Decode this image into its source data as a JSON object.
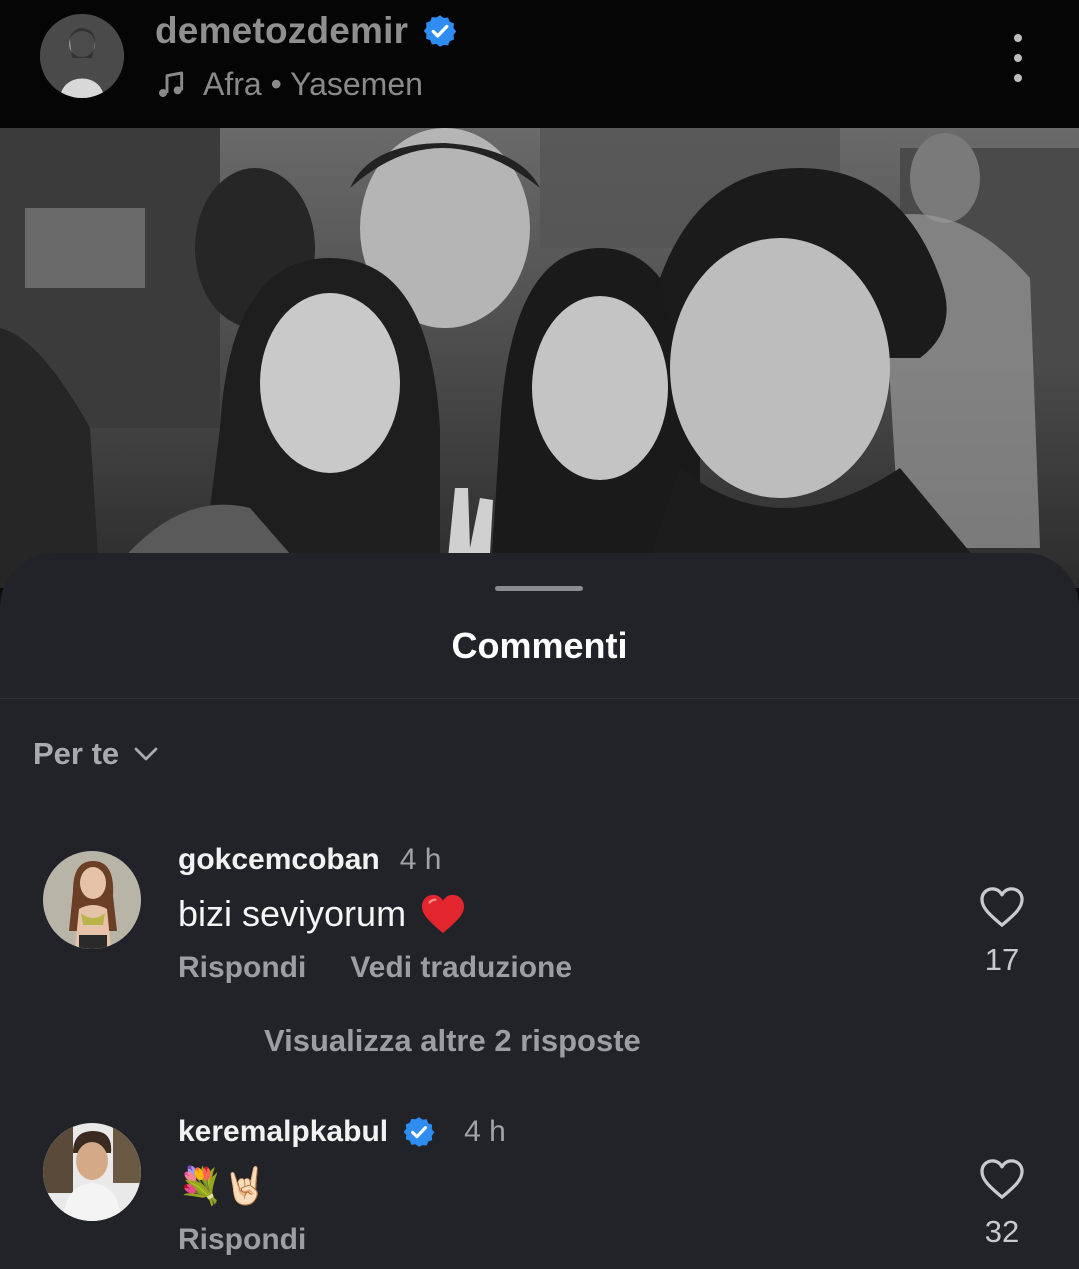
{
  "post": {
    "username": "demetozdemir",
    "music": "Afra • Yasemen"
  },
  "comments_sheet": {
    "title": "Commenti",
    "sort_label": "Per te",
    "comments": [
      {
        "username": "gokcemcoban",
        "time": "4 h",
        "text": "bizi seviyorum",
        "emoji": "❤️",
        "reply_label": "Rispondi",
        "translate_label": "Vedi traduzione",
        "likes": "17",
        "view_replies": "Visualizza altre 2 risposte"
      },
      {
        "username": "keremalpkabul",
        "time": "4 h",
        "text": "💐🤘🏻",
        "reply_label": "Rispondi",
        "likes": "32"
      }
    ]
  },
  "colors": {
    "verified": "#2f8cf0",
    "sheet_background": "#212328",
    "header_background": "#050505"
  }
}
